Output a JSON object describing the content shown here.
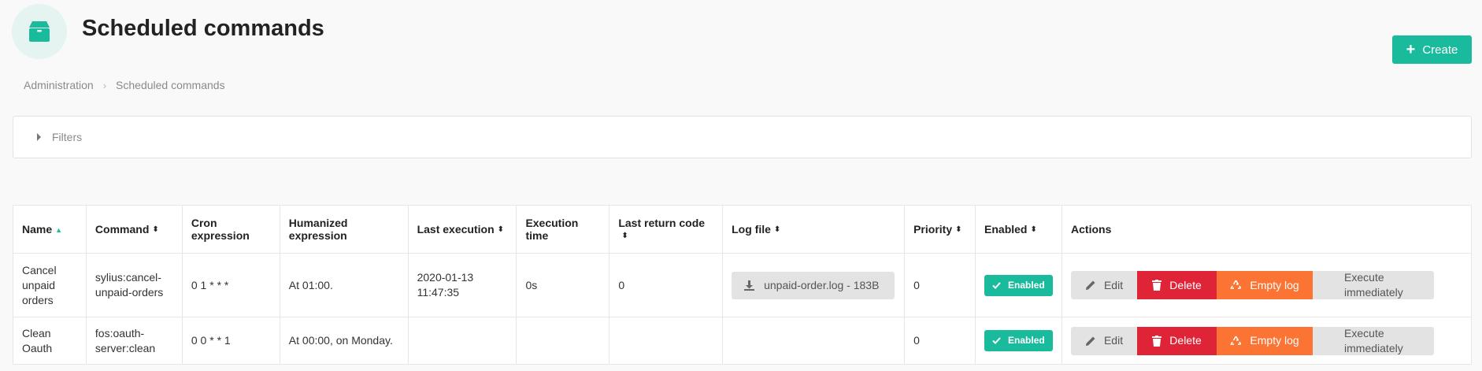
{
  "header": {
    "title": "Scheduled commands",
    "icon": "box-icon",
    "accent": "#1abb9c",
    "create_label": "Create"
  },
  "breadcrumb": {
    "items": [
      "Administration",
      "Scheduled commands"
    ]
  },
  "filters": {
    "label": "Filters"
  },
  "table": {
    "columns": [
      {
        "label": "Name",
        "sort": "asc"
      },
      {
        "label": "Command",
        "sort": "both"
      },
      {
        "label": "Cron expression",
        "sort": "none"
      },
      {
        "label": "Humanized expression",
        "sort": "none"
      },
      {
        "label": "Last execution",
        "sort": "both"
      },
      {
        "label": "Execution time",
        "sort": "none"
      },
      {
        "label": "Last return code",
        "sort": "both"
      },
      {
        "label": "Log file",
        "sort": "both"
      },
      {
        "label": "Priority",
        "sort": "both"
      },
      {
        "label": "Enabled",
        "sort": "both"
      },
      {
        "label": "Actions",
        "sort": "none"
      }
    ],
    "rows": [
      {
        "name": [
          "Cancel",
          "unpaid",
          "orders"
        ],
        "command": [
          "sylius:cancel-",
          "unpaid-orders"
        ],
        "cron": "0 1 * * *",
        "humanized": "At 01:00.",
        "last_execution": [
          "2020-01-13",
          "11:47:35"
        ],
        "execution_time": "0s",
        "last_return_code": "0",
        "log_file": "unpaid-order.log - 183B",
        "priority": "0",
        "enabled": "Enabled"
      },
      {
        "name": [
          "Clean",
          "Oauth"
        ],
        "command": [
          "fos:oauth-",
          "server:clean"
        ],
        "cron": "0 0 * * 1",
        "humanized": "At 00:00, on Monday.",
        "last_execution": [
          "",
          ""
        ],
        "execution_time": "",
        "last_return_code": "",
        "log_file": "",
        "priority": "0",
        "enabled": "Enabled"
      }
    ],
    "actions": {
      "edit": "Edit",
      "delete": "Delete",
      "empty_log": "Empty log",
      "execute": "Execute immediately"
    }
  },
  "colors": {
    "primary": "#1abb9c",
    "danger": "#e02437",
    "warning": "#fb7434",
    "neutral": "#e3e3e3"
  }
}
